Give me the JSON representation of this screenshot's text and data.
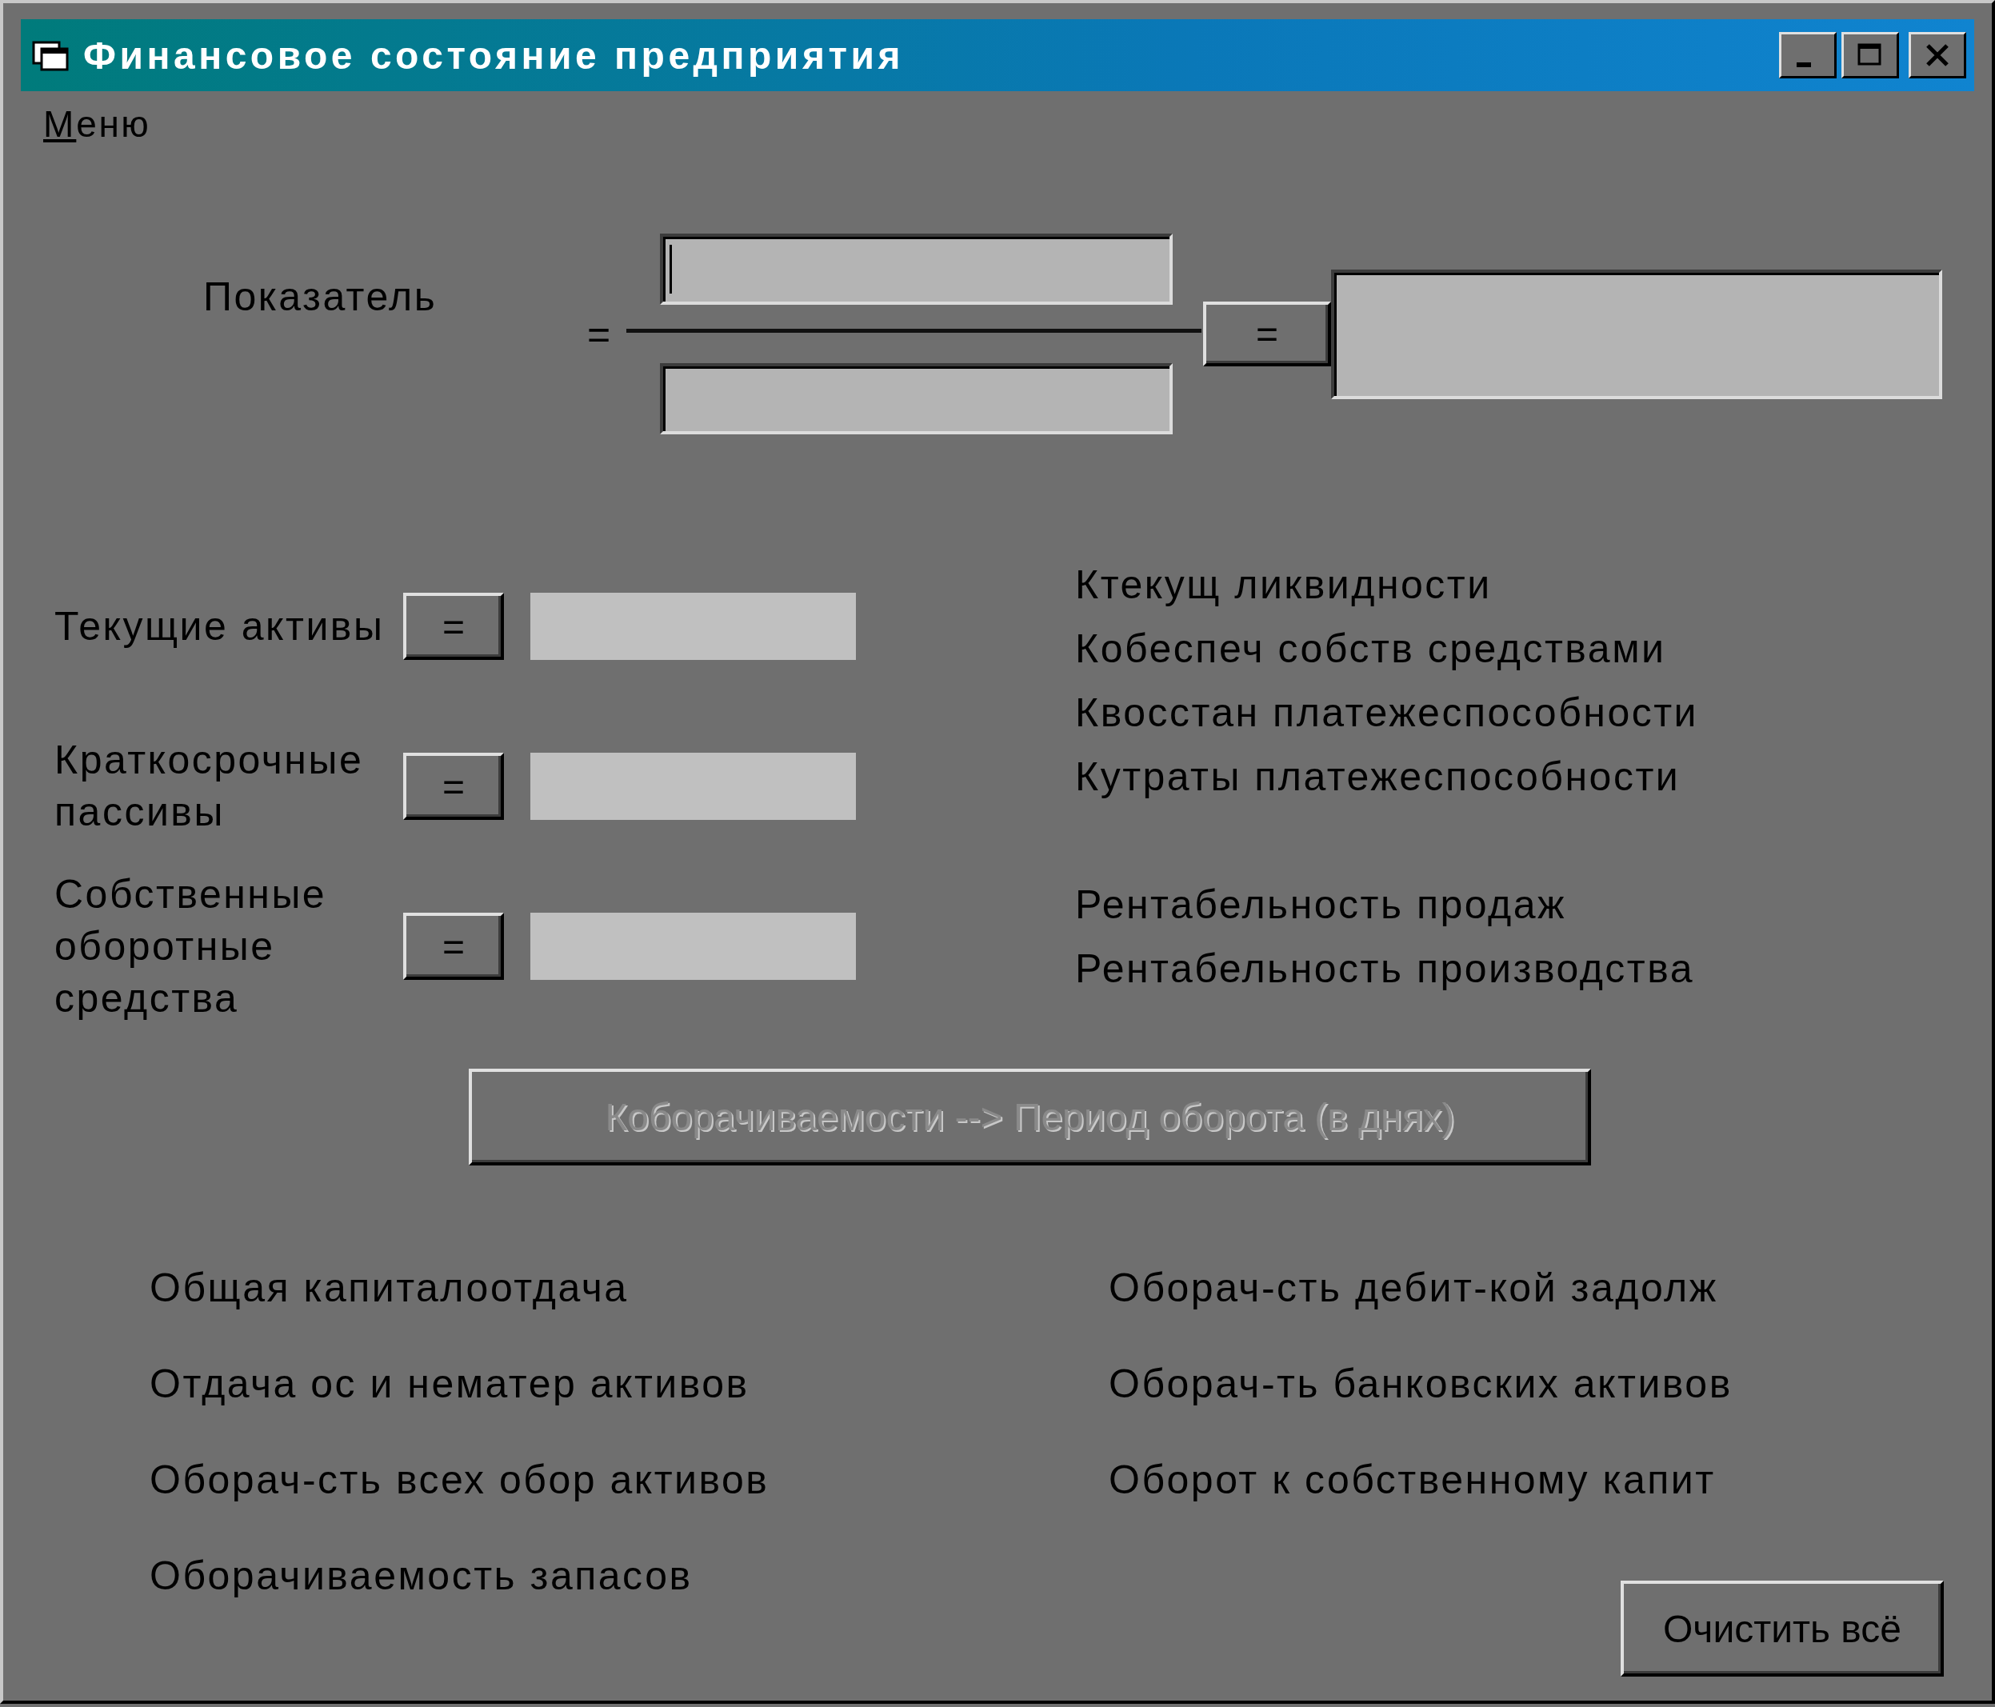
{
  "window": {
    "title": "Финансовое состояние предприятия"
  },
  "menu": [
    {
      "label": "Меню"
    }
  ],
  "formula": {
    "label": "Показатель",
    "equals_sign": "=",
    "numerator": {
      "focused": true
    },
    "denominator": {
      "focused": false
    },
    "button": "=",
    "result": {
      "focused": false
    }
  },
  "inputs": [
    {
      "label": "Текущие активы",
      "button": "="
    },
    {
      "label": "Краткосрочные пассивы",
      "button": "="
    },
    {
      "label": "Собственные оборотные средства",
      "button": "="
    }
  ],
  "liquidity_ratios": [
    "Ктекущ ликвидности",
    "Кобеспеч собств средствами",
    "Квосстан платежеспособности",
    "Кутраты платежеспособности"
  ],
  "profitability_ratios": [
    "Рентабельность продаж",
    "Рентабельность производства"
  ],
  "period_button": {
    "label": "Коборачиваемости --> Период оборота (в днях)",
    "disabled": true
  },
  "turnover_left": [
    "Общая капиталоотдача",
    "Отдача ос и нематер активов",
    "Оборач-сть всех обор активов",
    "Оборачиваемость запасов"
  ],
  "turnover_right": [
    "Оборач-сть дебит-кой задолж",
    "Оборач-ть банковских активов",
    "Оборот к собственному капит"
  ],
  "clear_button": "Очистить всё"
}
